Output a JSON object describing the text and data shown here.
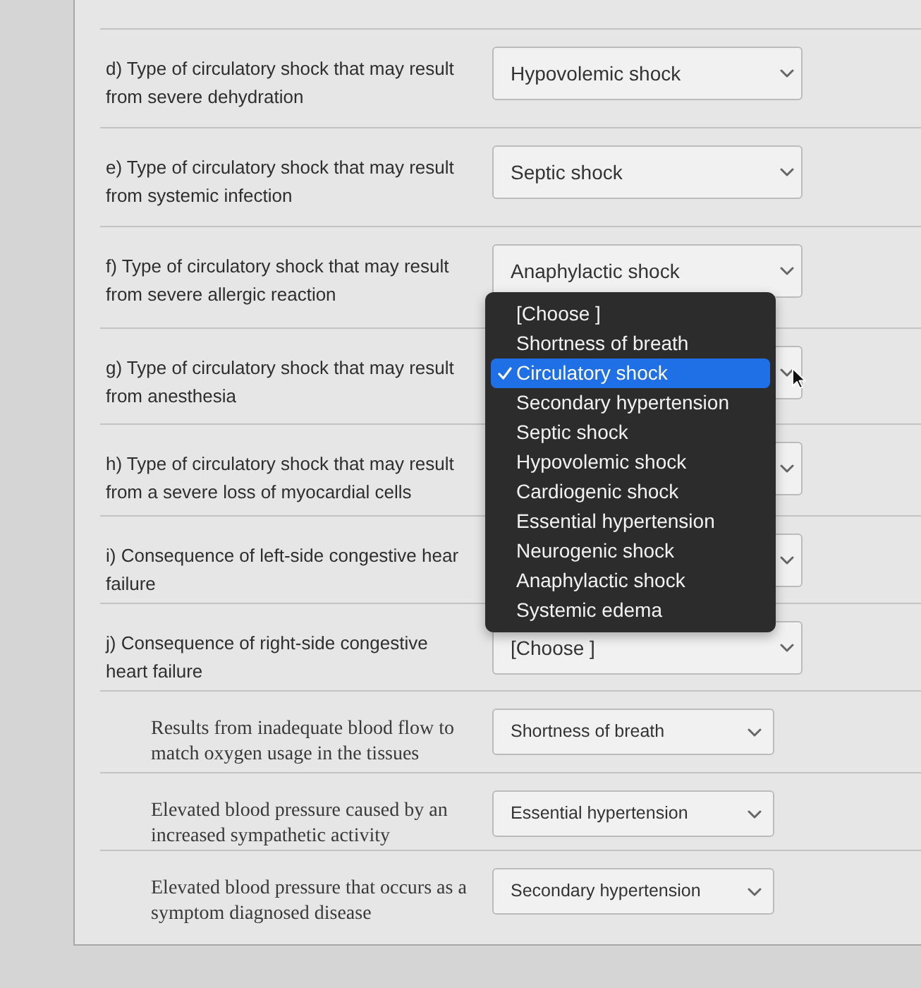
{
  "questions": [
    {
      "label": "d) Type of circulatory shock that may result from severe dehydration",
      "kind": "sans",
      "select": {
        "value": "Hypovolemic shock"
      }
    },
    {
      "label": "e) Type of circulatory shock that may result from systemic infection",
      "kind": "sans",
      "select": {
        "value": "Septic shock"
      }
    },
    {
      "label": "f) Type of circulatory shock that may result from severe allergic reaction",
      "kind": "sans",
      "select": {
        "value": "Anaphylactic shock"
      }
    },
    {
      "label": "g) Type of circulatory shock that may result from anesthesia",
      "kind": "sans",
      "select": {
        "open": true,
        "options": [
          {
            "label": "[Choose ]",
            "selected": false
          },
          {
            "label": "Shortness of breath",
            "selected": false
          },
          {
            "label": "Circulatory shock",
            "selected": true
          },
          {
            "label": "Secondary hypertension",
            "selected": false
          },
          {
            "label": "Septic shock",
            "selected": false
          },
          {
            "label": "Hypovolemic shock",
            "selected": false
          },
          {
            "label": "Cardiogenic shock",
            "selected": false
          },
          {
            "label": "Essential hypertension",
            "selected": false
          },
          {
            "label": "Neurogenic shock",
            "selected": false
          },
          {
            "label": "Anaphylactic shock",
            "selected": false
          },
          {
            "label": "Systemic edema",
            "selected": false
          }
        ]
      }
    },
    {
      "label": "h) Type of circulatory shock that may result from a severe loss of myocardial cells",
      "kind": "sans"
    },
    {
      "label": "i) Consequence of left-side congestive hear failure",
      "kind": "sans"
    },
    {
      "label": "j) Consequence of right-side congestive heart failure",
      "kind": "sans",
      "select": {
        "value": "[Choose ]"
      }
    },
    {
      "label": "Results from inadequate blood flow to match oxygen usage in the tissues",
      "kind": "serif",
      "select": {
        "value": "Shortness of breath"
      }
    },
    {
      "label": "Elevated blood pressure caused by an increased sympathetic activity",
      "kind": "serif",
      "select": {
        "value": "Essential hypertension"
      }
    },
    {
      "label": "Elevated blood pressure that occurs as a symptom diagnosed disease",
      "kind": "serif",
      "select": {
        "value": "Secondary hypertension"
      }
    }
  ]
}
